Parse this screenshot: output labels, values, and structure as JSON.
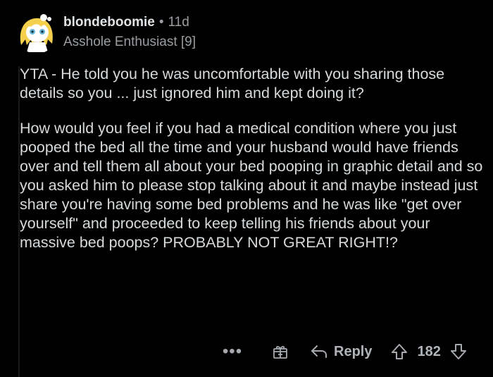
{
  "comment": {
    "author": "blondeboomie",
    "separator": "•",
    "age": "11d",
    "flair": "Asshole Enthusiast [9]",
    "paragraphs": [
      "YTA - He told you he was uncomfortable with you sharing those details so you ... just ignored him and kept doing it?",
      "How would you feel if you had a medical condition where you just pooped the bed all the time and your husband would have friends over and tell them all about your bed pooping in graphic detail and so you asked him to please stop talking about it and maybe instead just share you're having some bed problems and he was like \"get over yourself\" and proceeded to keep telling his friends about your massive bed poops? PROBABLY NOT GREAT RIGHT!?"
    ]
  },
  "actions": {
    "more": "•••",
    "reply_label": "Reply",
    "score": "182"
  },
  "icons": {
    "avatar": "avatar-icon",
    "more": "more-options-icon",
    "award": "award-gift-icon",
    "reply": "reply-arrow-icon",
    "upvote": "upvote-arrow-icon",
    "downvote": "downvote-arrow-icon"
  },
  "colors": {
    "background": "#000000",
    "text": "#d7dadc",
    "muted": "#9a9ea2",
    "avatar_fill": "#f5d04c"
  }
}
